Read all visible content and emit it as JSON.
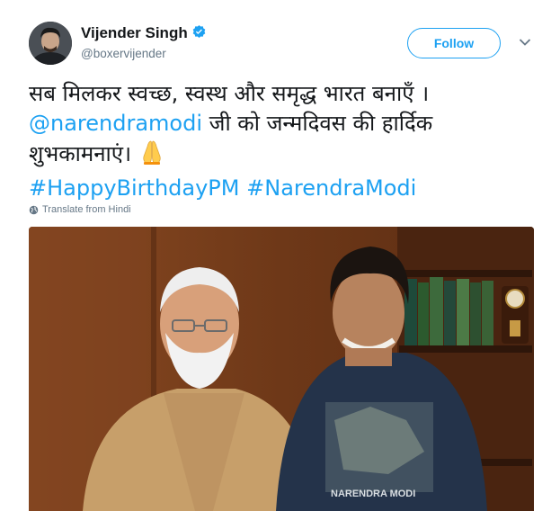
{
  "header": {
    "display_name": "Vijender Singh",
    "handle": "@boxervijender",
    "follow_label": "Follow"
  },
  "tweet": {
    "line1": "सब मिलकर स्वच्छ, स्वस्थ और समृद्ध भारत बनाएँ ।",
    "mention": "@narendramodi",
    "line2_rest": " जी को जन्मदिवस की हार्दिक",
    "line3": "शुभकामनाएं।",
    "hashtag1": "#HappyBirthdayPM",
    "hashtag2": "#NarendraModi",
    "translate_label": "Translate from Hindi"
  },
  "media": {
    "photo_shirt_text": "NARENDRA MODI"
  },
  "colors": {
    "link": "#1da1f2",
    "secondary_text": "#657786",
    "verified": "#1da1f2"
  }
}
